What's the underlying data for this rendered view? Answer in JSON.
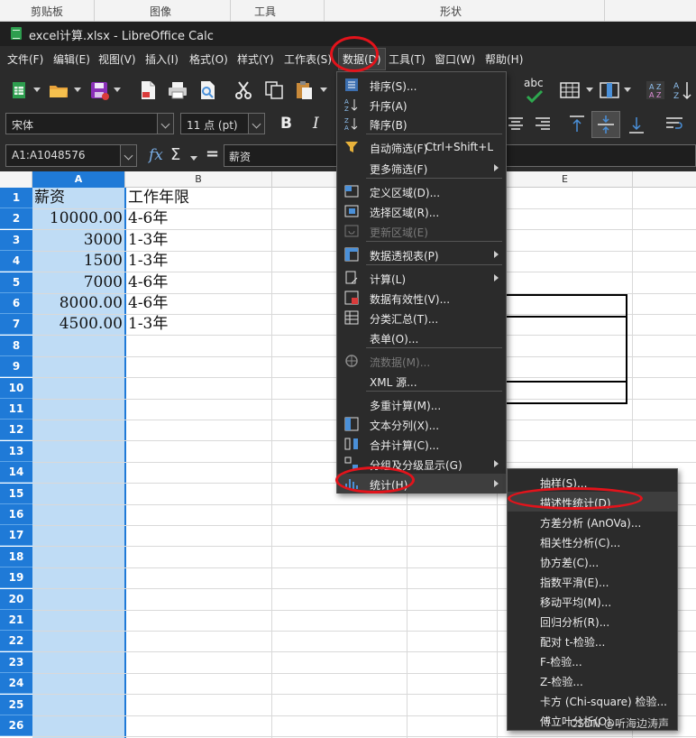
{
  "ribbon": {
    "groups": [
      "剪贴板",
      "图像",
      "工具",
      "形状"
    ]
  },
  "window": {
    "title": "excel计算.xlsx - LibreOffice Calc"
  },
  "menubar": {
    "items": [
      "文件(F)",
      "编辑(E)",
      "视图(V)",
      "插入(I)",
      "格式(O)",
      "样式(Y)",
      "工作表(S)",
      "数据(D)",
      "工具(T)",
      "窗口(W)",
      "帮助(H)"
    ]
  },
  "toolbar": {
    "font_name": "宋体",
    "font_size": "11 点 (pt)",
    "bold": "B",
    "italic": "I",
    "abc": "abc"
  },
  "formula_bar": {
    "name_box": "A1:A1048576",
    "fx": "fx",
    "sigma": "Σ",
    "equals": "=",
    "content": "薪资"
  },
  "sheet": {
    "columns": [
      "A",
      "B",
      "E"
    ],
    "rows": [
      "1",
      "2",
      "3",
      "4",
      "5",
      "6",
      "7",
      "8",
      "9",
      "10",
      "11",
      "12",
      "13",
      "14",
      "15",
      "16",
      "17",
      "18",
      "19",
      "20",
      "21",
      "22",
      "23",
      "24",
      "25",
      "26"
    ],
    "cells_a": [
      "薪资",
      "10000.00",
      "3000",
      "1500",
      "7000",
      "8000.00",
      "4500.00"
    ],
    "cells_b": [
      "工作年限",
      "4-6年",
      "1-3年",
      "1-3年",
      "4-6年",
      "4-6年",
      "1-3年"
    ]
  },
  "data_menu": {
    "items": [
      {
        "label": "排序(S)...",
        "icon": "sort-icon"
      },
      {
        "label": "升序(A)",
        "icon": "sort-ascending-icon"
      },
      {
        "label": "降序(B)",
        "icon": "sort-descending-icon"
      },
      {
        "label": "自动筛选(F)",
        "shortcut": "Ctrl+Shift+L",
        "icon": "autofilter-icon"
      },
      {
        "label": "更多筛选(F)",
        "submenu": true
      },
      {
        "label": "定义区域(D)...",
        "icon": "define-range-icon"
      },
      {
        "label": "选择区域(R)...",
        "icon": "select-range-icon"
      },
      {
        "label": "更新区域(E)",
        "disabled": true,
        "icon": "refresh-range-icon"
      },
      {
        "label": "数据透视表(P)",
        "submenu": true,
        "icon": "pivot-table-icon"
      },
      {
        "label": "计算(L)",
        "submenu": true,
        "icon": "calculate-icon"
      },
      {
        "label": "数据有效性(V)...",
        "icon": "validity-icon"
      },
      {
        "label": "分类汇总(T)...",
        "icon": "subtotals-icon"
      },
      {
        "label": "表单(O)..."
      },
      {
        "label": "流数据(M)...",
        "disabled": true,
        "icon": "stream-icon"
      },
      {
        "label": "XML 源..."
      },
      {
        "label": "多重计算(M)..."
      },
      {
        "label": "文本分列(X)...",
        "icon": "text-to-columns-icon"
      },
      {
        "label": "合并计算(C)...",
        "icon": "consolidate-icon"
      },
      {
        "label": "分组及分级显示(G)",
        "submenu": true,
        "icon": "group-outline-icon"
      },
      {
        "label": "统计(H)",
        "submenu": true,
        "icon": "statistics-icon"
      }
    ]
  },
  "stats_menu": {
    "items": [
      "抽样(S)...",
      "描述性统计(D)...",
      "方差分析 (AnOVa)...",
      "相关性分析(C)...",
      "协方差(C)...",
      "指数平滑(E)...",
      "移动平均(M)...",
      "回归分析(R)...",
      "配对 t-检验...",
      "F-检验...",
      "Z-检验...",
      "卡方 (Chi-square) 检验...",
      "傅立叶分析(O)..."
    ]
  },
  "watermark": "CSDN @听海边涛声",
  "colors": {
    "selection_blue": "#1f7ad7",
    "selection_fill": "#bfdcf5",
    "annotation_red": "#e3131b",
    "menu_bg": "#2b2b2b"
  }
}
